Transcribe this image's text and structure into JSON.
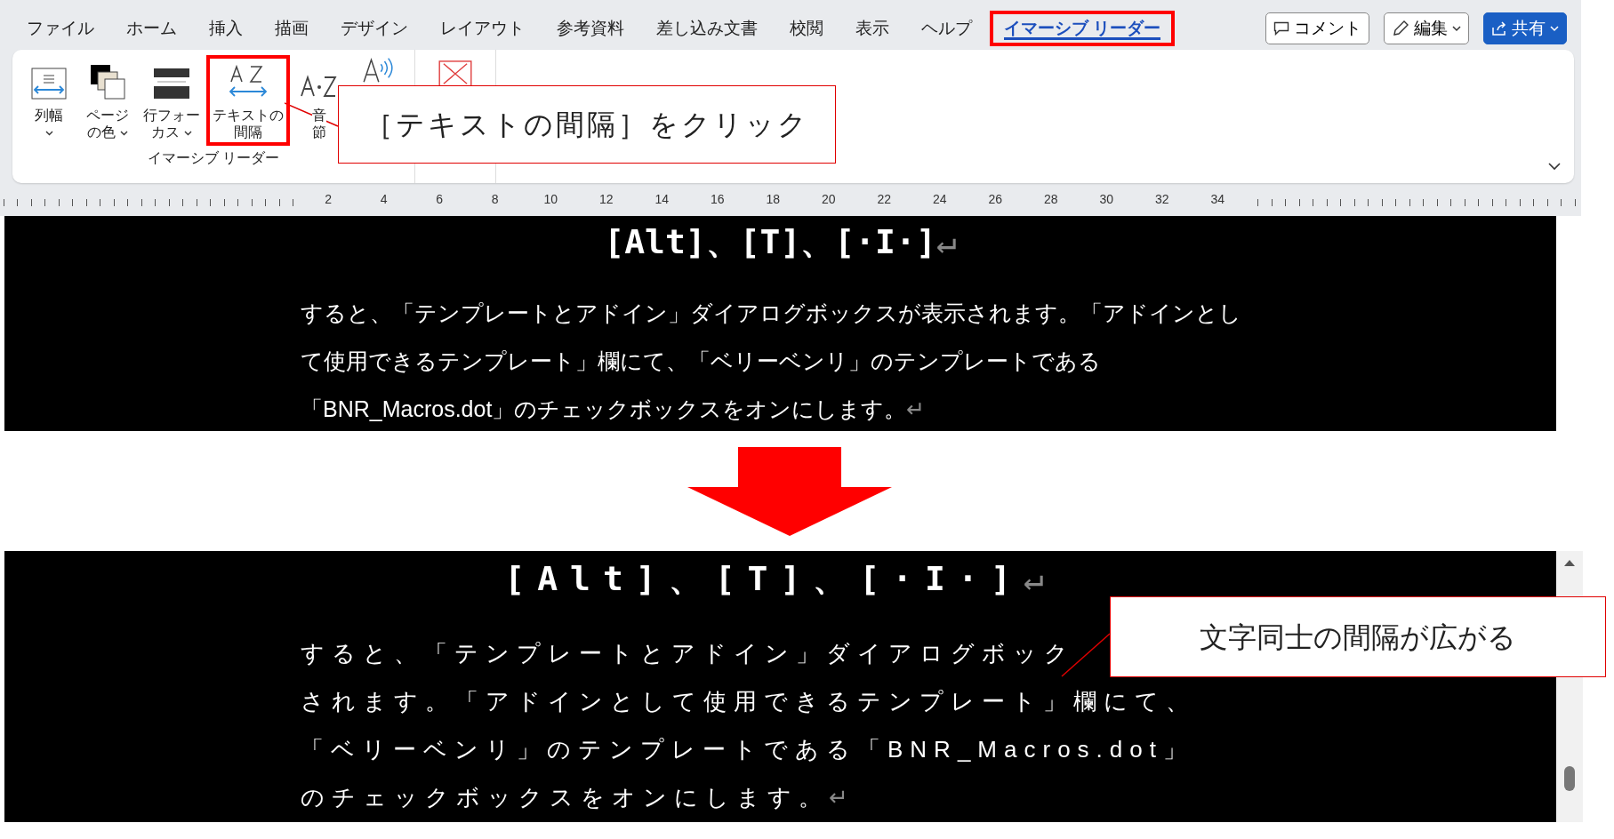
{
  "menu_tabs": [
    {
      "label": "ファイル",
      "selected": false
    },
    {
      "label": "ホーム",
      "selected": false
    },
    {
      "label": "挿入",
      "selected": false
    },
    {
      "label": "描画",
      "selected": false
    },
    {
      "label": "デザイン",
      "selected": false
    },
    {
      "label": "レイアウト",
      "selected": false
    },
    {
      "label": "参考資料",
      "selected": false
    },
    {
      "label": "差し込み文書",
      "selected": false
    },
    {
      "label": "校閲",
      "selected": false
    },
    {
      "label": "表示",
      "selected": false
    },
    {
      "label": "ヘルプ",
      "selected": false
    },
    {
      "label": "イマーシブ リーダー",
      "selected": true
    }
  ],
  "header_buttons": [
    {
      "kind": "comment",
      "label": "コメント"
    },
    {
      "kind": "edit",
      "label": "編集"
    },
    {
      "kind": "share",
      "label": "共有"
    }
  ],
  "ribbon": {
    "commands": [
      {
        "kind": "column-width",
        "label_lines": [
          "列幅"
        ],
        "dropdown": true,
        "highlighted": false
      },
      {
        "kind": "page-color",
        "label_lines": [
          "ページ",
          "の色"
        ],
        "dropdown": true,
        "highlighted": false
      },
      {
        "kind": "line-focus",
        "label_lines": [
          "行フォー",
          "カス"
        ],
        "dropdown": true,
        "highlighted": false
      },
      {
        "kind": "text-spacing",
        "label_lines": [
          "テキストの",
          "間隔"
        ],
        "dropdown": false,
        "highlighted": true
      },
      {
        "kind": "syllables",
        "label_lines": [
          "音",
          "節"
        ],
        "dropdown": false,
        "highlighted": false
      },
      {
        "kind": "read-aloud",
        "dropdown": false,
        "highlighted": false
      }
    ],
    "group_label": "イマーシブ リーダー"
  },
  "ruler": {
    "numbers": [
      "2",
      "4",
      "6",
      "8",
      "10",
      "12",
      "14",
      "16",
      "18",
      "20",
      "22",
      "24",
      "26",
      "28",
      "30",
      "32",
      "34"
    ]
  },
  "before": {
    "heading": "[Alt]、[T]、[·I·]",
    "heading_mark": "↵",
    "paragraph_lines": [
      "すると、「テンプレートとアドイン」ダイアログボックスが表示されます。「アドインとし",
      "て使用できるテンプレート」欄にて、「ベリーベンリ」のテンプレートである",
      "「BNR_Macros.dot」のチェックボックスをオンにします。"
    ],
    "paragraph_mark": "↵"
  },
  "after": {
    "heading": "[Alt]、[T]、[·I·]",
    "heading_mark": "↵",
    "paragraph_lines": [
      "すると、「テンプレートとアドイン」ダイアログボック",
      "されます。「アドインとして使用できるテンプレート」欄にて、",
      "「ベリーベンリ」のテンプレートである「BNR_Macros.dot」",
      "のチェックボックスをオンにします。"
    ],
    "paragraph_mark": "↵"
  },
  "callouts": [
    {
      "text": "［テキストの間隔］をクリック"
    },
    {
      "text": "文字同士の間隔が広がる"
    }
  ]
}
